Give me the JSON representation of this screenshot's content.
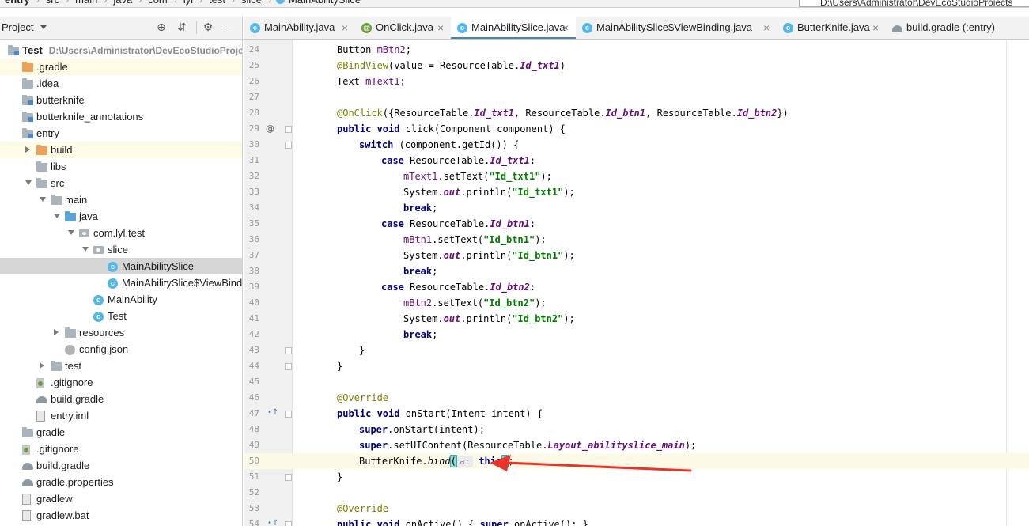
{
  "breadcrumb": {
    "items": [
      "entry",
      "src",
      "main",
      "java",
      "com",
      "lyl",
      "test",
      "slice",
      "MainAbilitySlice"
    ],
    "path": "D:\\Users\\Administrator\\DevEcoStudioProjects"
  },
  "project_panel": {
    "title": "Project",
    "tree": [
      {
        "label": "Test",
        "hint": "D:\\Users\\Administrator\\DevEcoStudioProjects\\T",
        "icon": "folder-module-icon",
        "indent": 0,
        "arrow": "none",
        "bold": true
      },
      {
        "label": ".gradle",
        "icon": "folder-orange-icon",
        "indent": 1,
        "arrow": "none",
        "highlight": "yellow"
      },
      {
        "label": ".idea",
        "icon": "folder-icon",
        "indent": 1,
        "arrow": "none"
      },
      {
        "label": "butterknife",
        "icon": "folder-module-icon",
        "indent": 1,
        "arrow": "none"
      },
      {
        "label": "butterknife_annotations",
        "icon": "folder-module-icon",
        "indent": 1,
        "arrow": "none"
      },
      {
        "label": "entry",
        "icon": "folder-module-icon",
        "indent": 1,
        "arrow": "none"
      },
      {
        "label": "build",
        "icon": "folder-orange-icon",
        "indent": 2,
        "arrow": "closed",
        "highlight": "yellow"
      },
      {
        "label": "libs",
        "icon": "folder-icon",
        "indent": 2,
        "arrow": "none"
      },
      {
        "label": "src",
        "icon": "folder-icon",
        "indent": 2,
        "arrow": "open"
      },
      {
        "label": "main",
        "icon": "folder-icon",
        "indent": 3,
        "arrow": "open"
      },
      {
        "label": "java",
        "icon": "folder-blue-icon",
        "indent": 4,
        "arrow": "open"
      },
      {
        "label": "com.lyl.test",
        "icon": "package-icon",
        "indent": 5,
        "arrow": "open"
      },
      {
        "label": "slice",
        "icon": "package-icon",
        "indent": 6,
        "arrow": "open"
      },
      {
        "label": "MainAbilitySlice",
        "icon": "class-icon",
        "indent": 7,
        "arrow": "none",
        "highlight": "gray"
      },
      {
        "label": "MainAbilitySlice$ViewBinding",
        "icon": "class-icon",
        "indent": 7,
        "arrow": "none"
      },
      {
        "label": "MainAbility",
        "icon": "class-icon",
        "indent": 6,
        "arrow": "none"
      },
      {
        "label": "Test",
        "icon": "class-icon",
        "indent": 6,
        "arrow": "none"
      },
      {
        "label": "resources",
        "icon": "folder-icon",
        "indent": 4,
        "arrow": "closed"
      },
      {
        "label": "config.json",
        "icon": "json-icon",
        "indent": 4,
        "arrow": "none"
      },
      {
        "label": "test",
        "icon": "folder-icon",
        "indent": 3,
        "arrow": "closed"
      },
      {
        "label": ".gitignore",
        "icon": "gitignore-icon",
        "indent": 2,
        "arrow": "none"
      },
      {
        "label": "build.gradle",
        "icon": "gradle-icon",
        "indent": 2,
        "arrow": "none"
      },
      {
        "label": "entry.iml",
        "icon": "file-icon",
        "indent": 2,
        "arrow": "none"
      },
      {
        "label": "gradle",
        "icon": "folder-icon",
        "indent": 1,
        "arrow": "none"
      },
      {
        "label": ".gitignore",
        "icon": "gitignore-icon",
        "indent": 1,
        "arrow": "none"
      },
      {
        "label": "build.gradle",
        "icon": "gradle-icon",
        "indent": 1,
        "arrow": "none"
      },
      {
        "label": "gradle.properties",
        "icon": "gradle-icon",
        "indent": 1,
        "arrow": "none"
      },
      {
        "label": "gradlew",
        "icon": "file-icon",
        "indent": 1,
        "arrow": "none"
      },
      {
        "label": "gradlew.bat",
        "icon": "file-icon",
        "indent": 1,
        "arrow": "none"
      }
    ]
  },
  "editor_tabs": [
    {
      "label": "MainAbility.java",
      "icon": "class-icon",
      "active": false
    },
    {
      "label": "OnClick.java",
      "icon": "annotation-icon",
      "active": false
    },
    {
      "label": "MainAbilitySlice.java",
      "icon": "class-icon",
      "active": true
    },
    {
      "label": "MainAbilitySlice$ViewBinding.java",
      "icon": "class-icon",
      "active": false
    },
    {
      "label": "ButterKnife.java",
      "icon": "class-icon",
      "active": false
    },
    {
      "label": "build.gradle (:entry)",
      "icon": "gradle-icon",
      "active": false
    }
  ],
  "editor": {
    "current_line": 50,
    "parameter_hint": "a:",
    "lines": [
      {
        "n": 24,
        "tokens": [
          [
            "",
            "Button "
          ],
          [
            "f",
            "mBtn2"
          ],
          [
            "",
            ";"
          ]
        ],
        "indent": 1
      },
      {
        "n": 25,
        "tokens": [
          [
            "a",
            "@BindView"
          ],
          [
            "",
            "(value = ResourceTable."
          ],
          [
            "st",
            "Id_txt1"
          ],
          [
            "",
            ")"
          ]
        ],
        "indent": 1
      },
      {
        "n": 26,
        "tokens": [
          [
            "",
            "Text "
          ],
          [
            "f",
            "mText1"
          ],
          [
            "",
            ";"
          ]
        ],
        "indent": 1
      },
      {
        "n": 27,
        "tokens": [],
        "indent": 0
      },
      {
        "n": 28,
        "tokens": [
          [
            "a",
            "@OnClick"
          ],
          [
            "",
            "({ResourceTable."
          ],
          [
            "st",
            "Id_txt1"
          ],
          [
            "",
            ", ResourceTable."
          ],
          [
            "st",
            "Id_btn1"
          ],
          [
            "",
            ", ResourceTable."
          ],
          [
            "st",
            "Id_btn2"
          ],
          [
            "",
            "})"
          ]
        ],
        "indent": 1
      },
      {
        "n": 29,
        "tokens": [
          [
            "k",
            "public void "
          ],
          [
            "",
            "click(Component component) {"
          ]
        ],
        "indent": 1
      },
      {
        "n": 30,
        "tokens": [
          [
            "k",
            "switch "
          ],
          [
            "",
            "(component.getId()) {"
          ]
        ],
        "indent": 2
      },
      {
        "n": 31,
        "tokens": [
          [
            "k",
            "case "
          ],
          [
            "",
            "ResourceTable."
          ],
          [
            "st",
            "Id_txt1"
          ],
          [
            "",
            ":"
          ]
        ],
        "indent": 3
      },
      {
        "n": 32,
        "tokens": [
          [
            "f",
            "mText1"
          ],
          [
            "",
            ".setText("
          ],
          [
            "s",
            "\"Id_txt1\""
          ],
          [
            "",
            ");"
          ]
        ],
        "indent": 4
      },
      {
        "n": 33,
        "tokens": [
          [
            "",
            "System."
          ],
          [
            "st",
            "out"
          ],
          [
            "",
            ".println("
          ],
          [
            "s",
            "\"Id_txt1\""
          ],
          [
            "",
            ");"
          ]
        ],
        "indent": 4
      },
      {
        "n": 34,
        "tokens": [
          [
            "k",
            "break"
          ],
          [
            "",
            ";"
          ]
        ],
        "indent": 4
      },
      {
        "n": 35,
        "tokens": [
          [
            "k",
            "case "
          ],
          [
            "",
            "ResourceTable."
          ],
          [
            "st",
            "Id_btn1"
          ],
          [
            "",
            ":"
          ]
        ],
        "indent": 3
      },
      {
        "n": 36,
        "tokens": [
          [
            "f",
            "mBtn1"
          ],
          [
            "",
            ".setText("
          ],
          [
            "s",
            "\"Id_btn1\""
          ],
          [
            "",
            ");"
          ]
        ],
        "indent": 4
      },
      {
        "n": 37,
        "tokens": [
          [
            "",
            "System."
          ],
          [
            "st",
            "out"
          ],
          [
            "",
            ".println("
          ],
          [
            "s",
            "\"Id_btn1\""
          ],
          [
            "",
            ");"
          ]
        ],
        "indent": 4
      },
      {
        "n": 38,
        "tokens": [
          [
            "k",
            "break"
          ],
          [
            "",
            ";"
          ]
        ],
        "indent": 4
      },
      {
        "n": 39,
        "tokens": [
          [
            "k",
            "case "
          ],
          [
            "",
            "ResourceTable."
          ],
          [
            "st",
            "Id_btn2"
          ],
          [
            "",
            ":"
          ]
        ],
        "indent": 3
      },
      {
        "n": 40,
        "tokens": [
          [
            "f",
            "mBtn2"
          ],
          [
            "",
            ".setText("
          ],
          [
            "s",
            "\"Id_btn2\""
          ],
          [
            "",
            ");"
          ]
        ],
        "indent": 4
      },
      {
        "n": 41,
        "tokens": [
          [
            "",
            "System."
          ],
          [
            "st",
            "out"
          ],
          [
            "",
            ".println("
          ],
          [
            "s",
            "\"Id_btn2\""
          ],
          [
            "",
            ");"
          ]
        ],
        "indent": 4
      },
      {
        "n": 42,
        "tokens": [
          [
            "k",
            "break"
          ],
          [
            "",
            ";"
          ]
        ],
        "indent": 4
      },
      {
        "n": 43,
        "tokens": [
          [
            "",
            "}"
          ]
        ],
        "indent": 2
      },
      {
        "n": 44,
        "tokens": [
          [
            "",
            "}"
          ]
        ],
        "indent": 1
      },
      {
        "n": 45,
        "tokens": [],
        "indent": 0
      },
      {
        "n": 46,
        "tokens": [
          [
            "a",
            "@Override"
          ]
        ],
        "indent": 1
      },
      {
        "n": 47,
        "tokens": [
          [
            "k",
            "public void "
          ],
          [
            "",
            "onStart(Intent intent) {"
          ]
        ],
        "indent": 1
      },
      {
        "n": 48,
        "tokens": [
          [
            "k",
            "super"
          ],
          [
            "",
            ".onStart(intent);"
          ]
        ],
        "indent": 2
      },
      {
        "n": 49,
        "tokens": [
          [
            "k",
            "super"
          ],
          [
            "",
            ".setUIContent(ResourceTable."
          ],
          [
            "st",
            "Layout_abilityslice_main"
          ],
          [
            "",
            ");"
          ]
        ],
        "indent": 2
      },
      {
        "n": 50,
        "tokens": [
          [
            "",
            "ButterKnife."
          ],
          [
            "sm",
            "bind"
          ],
          [
            "paren",
            "("
          ],
          [
            "hint",
            "a:"
          ],
          [
            "k",
            " this"
          ],
          [
            "caret",
            ""
          ],
          [
            "paren",
            ")"
          ],
          [
            "",
            ";"
          ]
        ],
        "indent": 2
      },
      {
        "n": 51,
        "tokens": [
          [
            "",
            "}"
          ]
        ],
        "indent": 1
      },
      {
        "n": 52,
        "tokens": [],
        "indent": 0
      },
      {
        "n": 53,
        "tokens": [
          [
            "a",
            "@Override"
          ]
        ],
        "indent": 1
      },
      {
        "n": 54,
        "tokens": [
          [
            "k",
            "public void "
          ],
          [
            "",
            "onActive() { "
          ],
          [
            "k",
            "super"
          ],
          [
            "",
            ".onActive(); }"
          ]
        ],
        "indent": 1
      }
    ]
  },
  "gutter_marks": [
    {
      "line": 29,
      "icon": "override-icon",
      "glyph": "@"
    },
    {
      "line": 47,
      "icon": "implements-up-icon",
      "glyph": "•↑"
    },
    {
      "line": 54,
      "icon": "implements-up-icon",
      "glyph": "•↑"
    }
  ],
  "fold_lines": [
    29,
    30,
    43,
    44,
    47,
    51,
    54
  ],
  "annotation": {
    "color": "#e8342b",
    "type": "red-arrow"
  }
}
